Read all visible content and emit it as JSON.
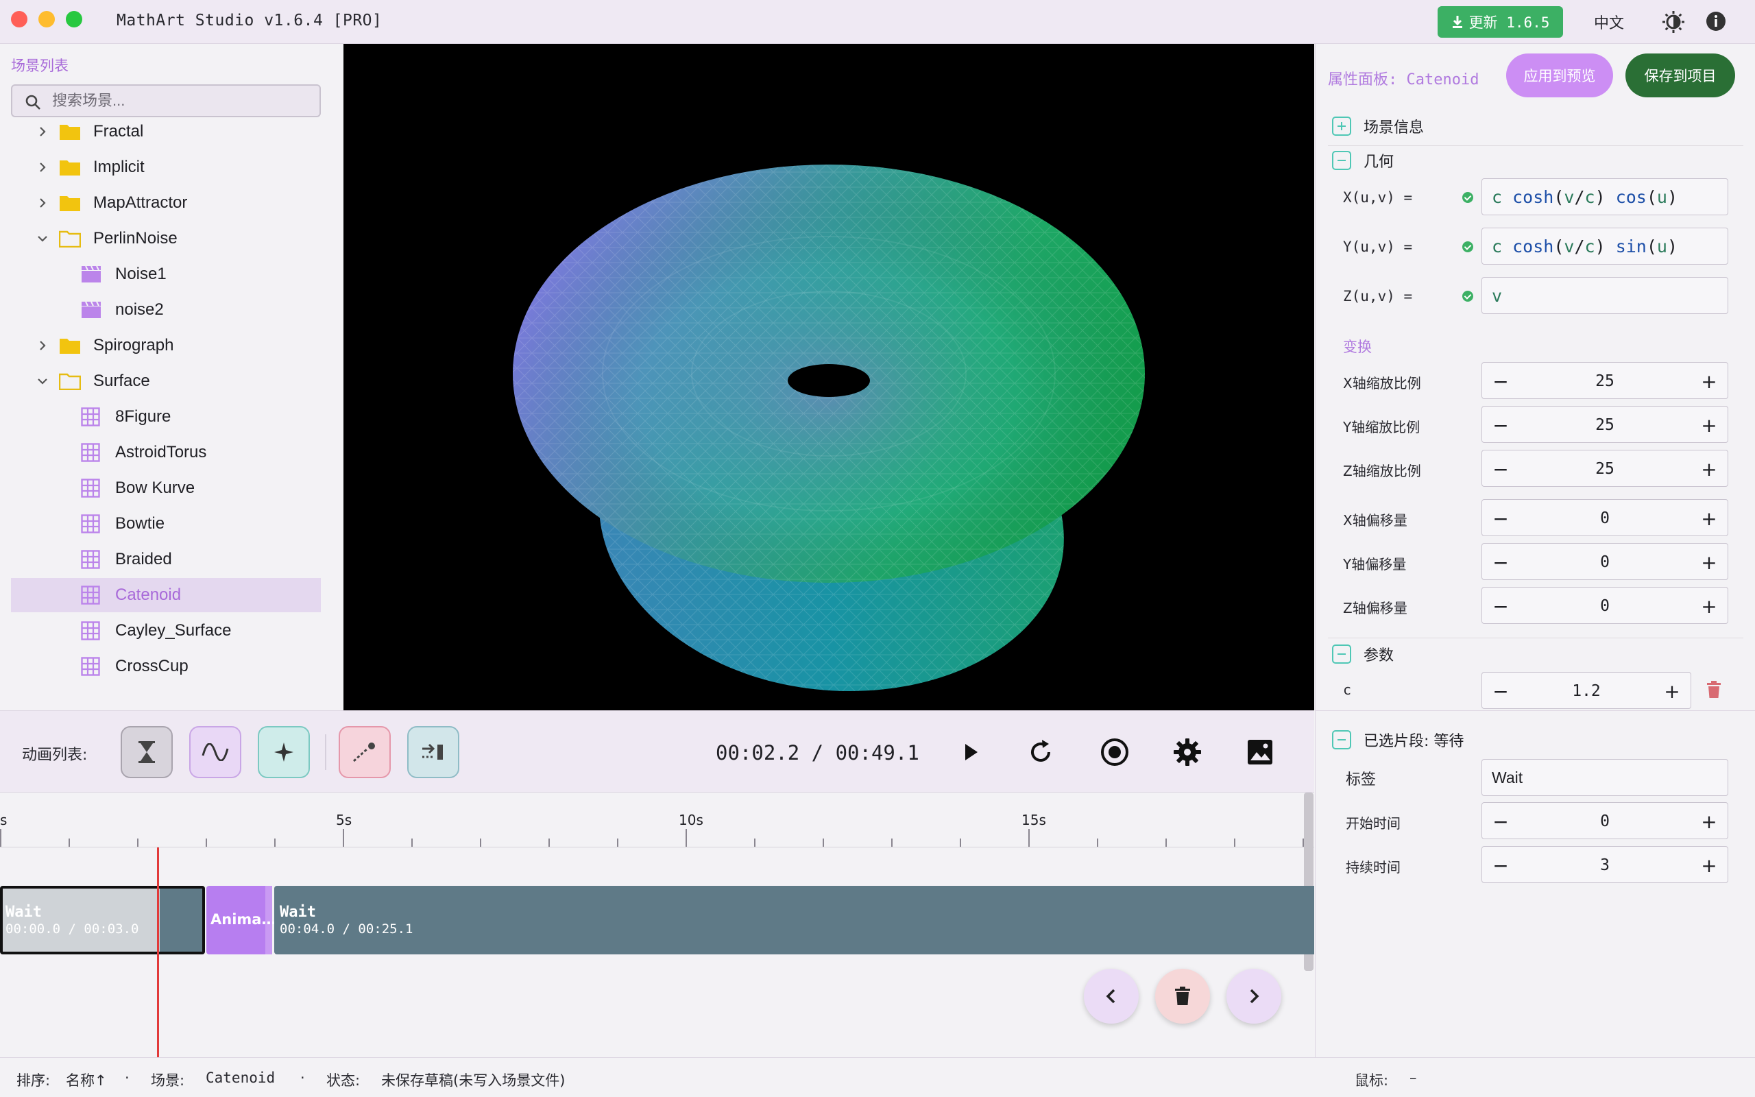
{
  "app": {
    "title": "MathArt Studio v1.6.4 [PRO]",
    "update_label": "更新 1.6.5",
    "lang_label": "中文"
  },
  "sidebar": {
    "title": "场景列表",
    "search_placeholder": "搜索场景...",
    "items": [
      {
        "label": "Fractal",
        "type": "folder",
        "expanded": false
      },
      {
        "label": "Implicit",
        "type": "folder",
        "expanded": false
      },
      {
        "label": "MapAttractor",
        "type": "folder",
        "expanded": false
      },
      {
        "label": "PerlinNoise",
        "type": "folder",
        "expanded": true
      },
      {
        "label": "Noise1",
        "type": "scene-clapper"
      },
      {
        "label": "noise2",
        "type": "scene-clapper"
      },
      {
        "label": "Spirograph",
        "type": "folder",
        "expanded": false
      },
      {
        "label": "Surface",
        "type": "folder",
        "expanded": true
      },
      {
        "label": "8Figure",
        "type": "scene-grid"
      },
      {
        "label": "AstroidTorus",
        "type": "scene-grid"
      },
      {
        "label": "Bow Kurve",
        "type": "scene-grid"
      },
      {
        "label": "Bowtie",
        "type": "scene-grid"
      },
      {
        "label": "Braided",
        "type": "scene-grid"
      },
      {
        "label": "Catenoid",
        "type": "scene-grid",
        "selected": true
      },
      {
        "label": "Cayley_Surface",
        "type": "scene-grid"
      },
      {
        "label": "CrossCup",
        "type": "scene-grid"
      }
    ]
  },
  "panel": {
    "title": "属性面板: Catenoid",
    "apply_label": "应用到预览",
    "save_label": "保存到项目",
    "sections": {
      "scene_info": "场景信息",
      "geometry": "几何",
      "transform": "变换",
      "params": "参数"
    },
    "equations": [
      {
        "label": "X(u,v) =",
        "tokens": [
          [
            "v",
            "c"
          ],
          [
            "p",
            " "
          ],
          [
            "f",
            "cosh"
          ],
          [
            "p",
            "("
          ],
          [
            "v",
            "v"
          ],
          [
            "p",
            "/"
          ],
          [
            "v",
            "c"
          ],
          [
            "p",
            ") "
          ],
          [
            "f",
            "cos"
          ],
          [
            "p",
            "("
          ],
          [
            "v",
            "u"
          ],
          [
            "p",
            ")"
          ]
        ]
      },
      {
        "label": "Y(u,v) =",
        "tokens": [
          [
            "v",
            "c"
          ],
          [
            "p",
            " "
          ],
          [
            "f",
            "cosh"
          ],
          [
            "p",
            "("
          ],
          [
            "v",
            "v"
          ],
          [
            "p",
            "/"
          ],
          [
            "v",
            "c"
          ],
          [
            "p",
            ") "
          ],
          [
            "f",
            "sin"
          ],
          [
            "p",
            "("
          ],
          [
            "v",
            "u"
          ],
          [
            "p",
            ")"
          ]
        ]
      },
      {
        "label": "Z(u,v) =",
        "tokens": [
          [
            "v",
            "v"
          ]
        ]
      }
    ],
    "transform": [
      {
        "label": "X轴缩放比例",
        "value": "25"
      },
      {
        "label": "Y轴缩放比例",
        "value": "25"
      },
      {
        "label": "Z轴缩放比例",
        "value": "25"
      },
      {
        "label": "X轴偏移量",
        "value": "0"
      },
      {
        "label": "Y轴偏移量",
        "value": "0"
      },
      {
        "label": "Z轴偏移量",
        "value": "0"
      }
    ],
    "param": {
      "label": "c",
      "value": "1.2"
    }
  },
  "anim": {
    "label": "动画列表:",
    "time": "00:02.2 / 00:49.1"
  },
  "timeline": {
    "ticks": [
      {
        "label": "s"
      },
      {
        "label": "5s"
      },
      {
        "label": "10s"
      },
      {
        "label": "15s"
      }
    ],
    "clips": [
      {
        "name": "Wait",
        "time": "00:00.0 / 00:03.0"
      },
      {
        "name": "Anima…",
        "time": ""
      },
      {
        "name": "Wait",
        "time": "00:04.0 / 00:25.1"
      }
    ]
  },
  "segment": {
    "title": "已选片段: 等待",
    "tag_label": "标签",
    "tag_value": "Wait",
    "start_label": "开始时间",
    "start_value": "0",
    "duration_label": "持续时间",
    "duration_value": "3"
  },
  "status": {
    "sort_label": "排序:",
    "sort_value": "名称↑",
    "scene_label": "场景:",
    "scene_value": "Catenoid",
    "state_label": "状态:",
    "state_value": "未保存草稿(未写入场景文件)",
    "mouse_label": "鼠标:",
    "mouse_value": "–",
    "sep": "·"
  },
  "colors": {
    "accent": "#a86ad9",
    "save_green": "#2a6f35",
    "update_green": "#3cb064",
    "clip_slate": "#5f7a87",
    "clip_purple": "#b77ef0",
    "playhead": "#e23a3a"
  }
}
